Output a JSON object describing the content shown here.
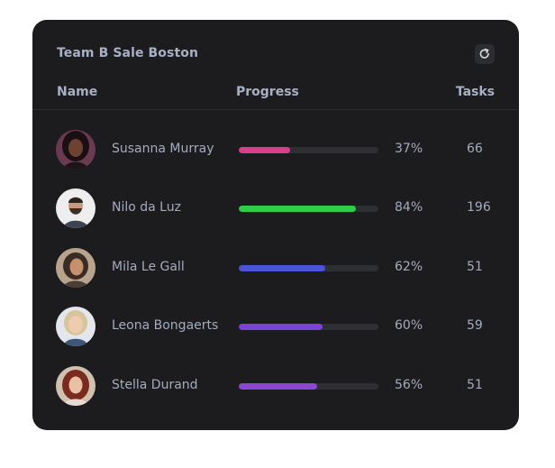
{
  "widget": {
    "title": "Team B Sale Boston",
    "refresh_icon": "refresh-icon"
  },
  "columns": {
    "name": "Name",
    "progress": "Progress",
    "tasks": "Tasks"
  },
  "members": [
    {
      "name": "Susanna Murray",
      "progress": 37,
      "progress_label": "37%",
      "tasks": "66",
      "color": "#d63f8c"
    },
    {
      "name": "Nilo da Luz",
      "progress": 84,
      "progress_label": "84%",
      "tasks": "196",
      "color": "#2ecc47"
    },
    {
      "name": "Mila Le Gall",
      "progress": 62,
      "progress_label": "62%",
      "tasks": "51",
      "color": "#4b53d6"
    },
    {
      "name": "Leona Bongaerts",
      "progress": 60,
      "progress_label": "60%",
      "tasks": "59",
      "color": "#7a45d6"
    },
    {
      "name": "Stella Durand",
      "progress": 56,
      "progress_label": "56%",
      "tasks": "51",
      "color": "#8a47d2"
    }
  ]
}
